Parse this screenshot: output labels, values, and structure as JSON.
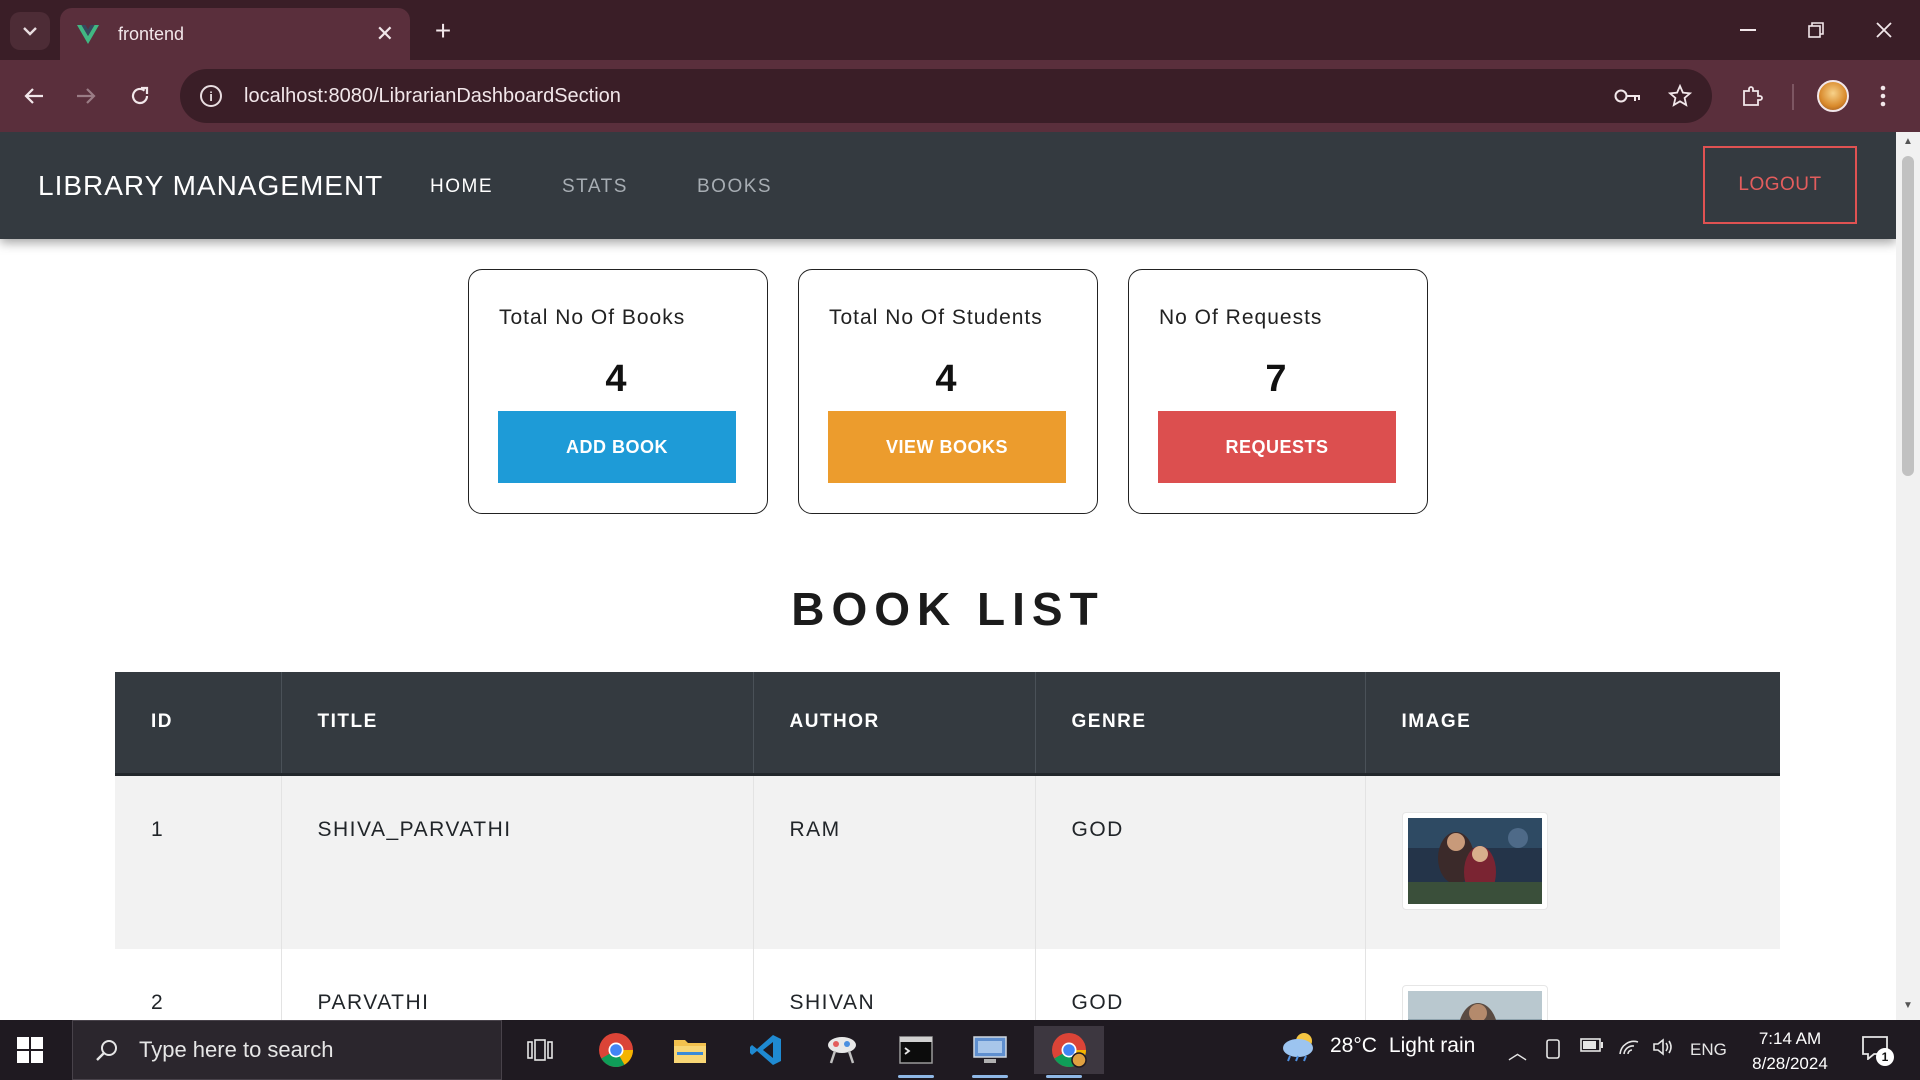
{
  "browser": {
    "tab_title": "frontend",
    "url": "localhost:8080/LibrarianDashboardSection",
    "tab_search_icon": "chevron-down-icon",
    "new_tab_icon": "plus-icon"
  },
  "navbar": {
    "brand": "LIBRARY MANAGEMENT",
    "links": [
      {
        "label": "HOME",
        "active": true
      },
      {
        "label": "STATS",
        "active": false
      },
      {
        "label": "BOOKS",
        "active": false
      }
    ],
    "logout_label": "LOGOUT"
  },
  "cards": [
    {
      "label": "Total No Of Books",
      "value": "4",
      "button": "ADD BOOK",
      "color": "#1e9bd7"
    },
    {
      "label": "Total No Of Students",
      "value": "4",
      "button": "VIEW BOOKS",
      "color": "#ec9c2d"
    },
    {
      "label": "No Of Requests",
      "value": "7",
      "button": "REQUESTS",
      "color": "#dc4f4f"
    }
  ],
  "book_list": {
    "title": "BOOK LIST",
    "columns": [
      "ID",
      "TITLE",
      "AUTHOR",
      "GENRE",
      "IMAGE"
    ],
    "rows": [
      {
        "id": "1",
        "title": "SHIVA_PARVATHI",
        "author": "RAM",
        "genre": "GOD"
      },
      {
        "id": "2",
        "title": "PARVATHI",
        "author": "SHIVAN",
        "genre": "GOD"
      }
    ]
  },
  "taskbar": {
    "search_placeholder": "Type here to search",
    "weather_temp": "28°C",
    "weather_desc": "Light rain",
    "language": "ENG",
    "time": "7:14 AM",
    "date": "8/28/2024",
    "notification_count": "1"
  },
  "colors": {
    "chrome_dark": "#3a1e27",
    "chrome_toolbar": "#5a2f3c",
    "navbar": "#343a40",
    "logout": "#e05252"
  }
}
